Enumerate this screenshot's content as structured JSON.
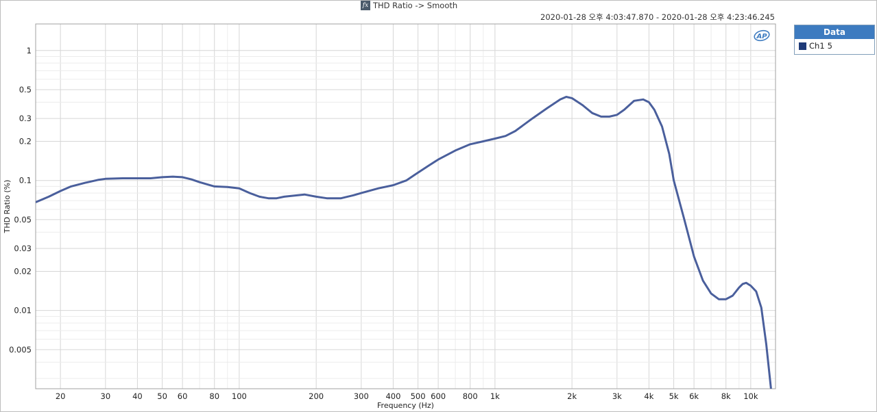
{
  "window": {
    "title": "THD Ratio -> Smooth",
    "timestamp": "2020-01-28 오후 4:03:47.870 - 2020-01-28 오후 4:23:46.245",
    "title_icon": "fx-icon",
    "logo_text": "AP"
  },
  "legend": {
    "header": "Data",
    "items": [
      {
        "label": "Ch1",
        "value": "5",
        "color": "#1e3a78"
      }
    ]
  },
  "chart_data": {
    "type": "line",
    "title": "THD Ratio -> Smooth",
    "xlabel": "Frequency (Hz)",
    "ylabel": "THD Ratio (%)",
    "x_scale": "log",
    "y_scale": "log",
    "xlim": [
      16,
      12500
    ],
    "ylim": [
      0.0025,
      1.6
    ],
    "grid": true,
    "legend_position": "right",
    "line_color": "#4a5f9c",
    "x_ticks": [
      {
        "value": 20,
        "label": "20"
      },
      {
        "value": 30,
        "label": "30"
      },
      {
        "value": 40,
        "label": "40"
      },
      {
        "value": 50,
        "label": "50"
      },
      {
        "value": 60,
        "label": "60"
      },
      {
        "value": 80,
        "label": "80"
      },
      {
        "value": 100,
        "label": "100"
      },
      {
        "value": 200,
        "label": "200"
      },
      {
        "value": 300,
        "label": "300"
      },
      {
        "value": 400,
        "label": "400"
      },
      {
        "value": 500,
        "label": "500"
      },
      {
        "value": 600,
        "label": "600"
      },
      {
        "value": 800,
        "label": "800"
      },
      {
        "value": 1000,
        "label": "1k"
      },
      {
        "value": 2000,
        "label": "2k"
      },
      {
        "value": 3000,
        "label": "3k"
      },
      {
        "value": 4000,
        "label": "4k"
      },
      {
        "value": 5000,
        "label": "5k"
      },
      {
        "value": 6000,
        "label": "6k"
      },
      {
        "value": 8000,
        "label": "8k"
      },
      {
        "value": 10000,
        "label": "10k"
      }
    ],
    "y_ticks": [
      {
        "value": 1,
        "label": "1"
      },
      {
        "value": 0.5,
        "label": "0.5"
      },
      {
        "value": 0.3,
        "label": "0.3"
      },
      {
        "value": 0.2,
        "label": "0.2"
      },
      {
        "value": 0.1,
        "label": "0.1"
      },
      {
        "value": 0.05,
        "label": "0.05"
      },
      {
        "value": 0.03,
        "label": "0.03"
      },
      {
        "value": 0.02,
        "label": "0.02"
      },
      {
        "value": 0.01,
        "label": "0.01"
      },
      {
        "value": 0.005,
        "label": "0.005"
      }
    ],
    "series": [
      {
        "name": "Ch1",
        "x": [
          16,
          18,
          20,
          22,
          25,
          28,
          30,
          35,
          40,
          45,
          50,
          55,
          60,
          65,
          70,
          80,
          90,
          100,
          110,
          120,
          130,
          140,
          150,
          160,
          180,
          200,
          220,
          250,
          280,
          300,
          350,
          400,
          450,
          500,
          550,
          600,
          700,
          800,
          900,
          1000,
          1100,
          1200,
          1400,
          1600,
          1800,
          1900,
          2000,
          2200,
          2400,
          2600,
          2800,
          3000,
          3200,
          3500,
          3800,
          4000,
          4200,
          4500,
          4800,
          5000,
          5500,
          6000,
          6500,
          7000,
          7500,
          8000,
          8500,
          9000,
          9300,
          9600,
          10000,
          10500,
          11000,
          11500,
          12000
        ],
        "y": [
          0.068,
          0.075,
          0.083,
          0.09,
          0.096,
          0.101,
          0.103,
          0.104,
          0.104,
          0.104,
          0.106,
          0.107,
          0.106,
          0.102,
          0.097,
          0.09,
          0.089,
          0.087,
          0.08,
          0.075,
          0.073,
          0.073,
          0.075,
          0.076,
          0.078,
          0.075,
          0.073,
          0.073,
          0.077,
          0.08,
          0.087,
          0.092,
          0.1,
          0.115,
          0.13,
          0.145,
          0.17,
          0.19,
          0.2,
          0.21,
          0.22,
          0.24,
          0.3,
          0.36,
          0.42,
          0.44,
          0.43,
          0.38,
          0.33,
          0.31,
          0.31,
          0.32,
          0.35,
          0.41,
          0.42,
          0.4,
          0.35,
          0.26,
          0.16,
          0.1,
          0.05,
          0.026,
          0.017,
          0.0135,
          0.0122,
          0.0122,
          0.013,
          0.015,
          0.016,
          0.0163,
          0.0155,
          0.014,
          0.0105,
          0.0055,
          0.0025
        ]
      }
    ]
  }
}
